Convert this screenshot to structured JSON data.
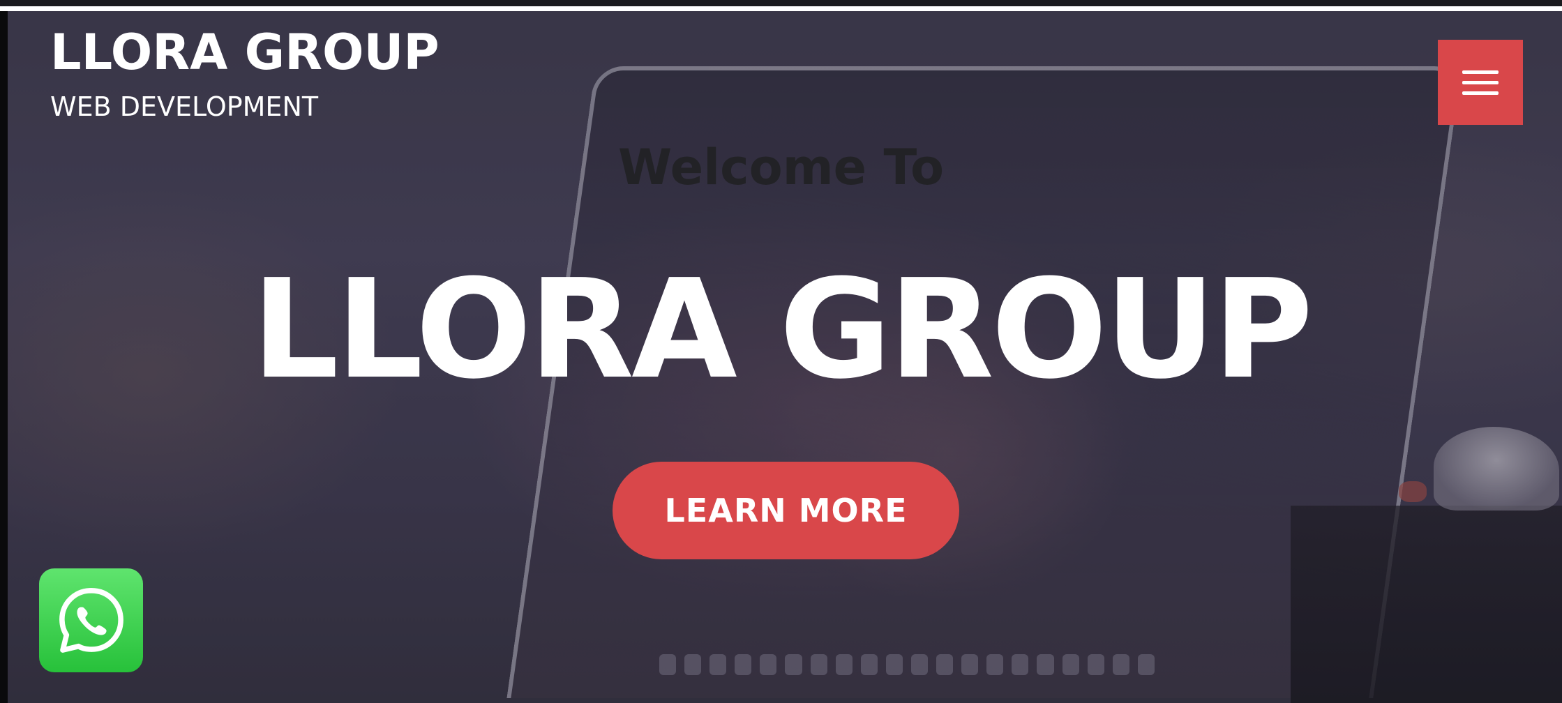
{
  "header": {
    "brand_title": "LLORA GROUP",
    "brand_subtitle": "WEB DEVELOPMENT",
    "menu_icon": "hamburger-menu-icon"
  },
  "hero": {
    "welcome": "Welcome To",
    "title": "LLORA GROUP",
    "cta_label": "LEARN MORE"
  },
  "floating": {
    "whatsapp_icon": "whatsapp-icon"
  },
  "colors": {
    "accent": "#d9474a",
    "whatsapp_green": "#27c13a",
    "text_light": "#ffffff",
    "text_dark": "#222226"
  }
}
